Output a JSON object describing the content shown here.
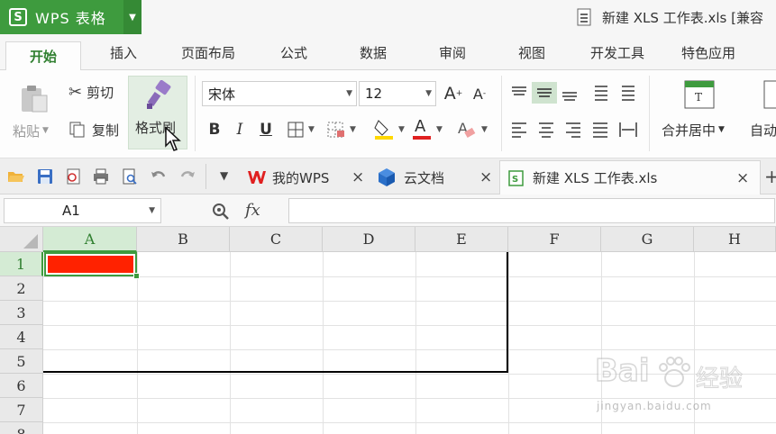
{
  "app": {
    "logo": "S",
    "name": "WPS 表格",
    "document_title": "新建 XLS 工作表.xls [兼容"
  },
  "ribbon_tabs": [
    "开始",
    "插入",
    "页面布局",
    "公式",
    "数据",
    "审阅",
    "视图",
    "开发工具",
    "特色应用"
  ],
  "active_ribbon_tab": "开始",
  "toolbar": {
    "paste": "粘贴",
    "cut": "剪切",
    "copy": "复制",
    "format_painter": "格式刷",
    "font_name": "宋体",
    "font_size": "12",
    "bold": "B",
    "italic": "I",
    "underline": "U",
    "font_color_letter": "A",
    "grow_font": "A",
    "shrink_font": "A",
    "merge_center": "合并居中",
    "auto_wrap": "自动",
    "fill_color": "#ffd800",
    "font_color": "#e02020"
  },
  "doc_tabs": [
    {
      "label": "我的WPS",
      "icon": "wps-icon"
    },
    {
      "label": "云文档",
      "icon": "cloud-docs-icon"
    },
    {
      "label": "新建 XLS 工作表.xls",
      "icon": "spreadsheet-icon",
      "active": true
    }
  ],
  "formula_bar": {
    "name_box": "A1",
    "fx": "fx",
    "value": ""
  },
  "grid": {
    "columns": [
      "A",
      "B",
      "C",
      "D",
      "E",
      "F",
      "G",
      "H"
    ],
    "rows": [
      "1",
      "2",
      "3",
      "4",
      "5",
      "6",
      "7",
      "8"
    ],
    "selected_cell": "A1",
    "a1_fill": "#ff2200",
    "border_color": "#000000"
  },
  "watermark": {
    "brand": "Bai",
    "brand_cn": "经验",
    "url": "jingyan.baidu.com"
  }
}
